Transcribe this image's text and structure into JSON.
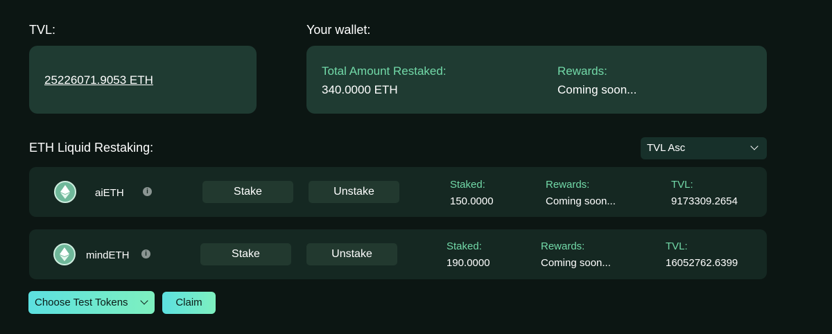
{
  "tvl": {
    "label": "TVL:",
    "value": "25226071.9053 ETH"
  },
  "wallet": {
    "label": "Your wallet:",
    "total_label": "Total Amount Restaked:",
    "total_value": "340.0000 ETH",
    "rewards_label": "Rewards:",
    "rewards_value": "Coming soon..."
  },
  "section": {
    "title": "ETH Liquid Restaking:",
    "sort_selected": "TVL Asc"
  },
  "rows": [
    {
      "name": "aiETH",
      "stake_label": "Stake",
      "unstake_label": "Unstake",
      "staked_label": "Staked:",
      "staked_value": "150.0000",
      "rewards_label": "Rewards:",
      "rewards_value": "Coming soon...",
      "tvl_label": "TVL:",
      "tvl_value": "9173309.2654"
    },
    {
      "name": "mindETH",
      "stake_label": "Stake",
      "unstake_label": "Unstake",
      "staked_label": "Staked:",
      "staked_value": "190.0000",
      "rewards_label": "Rewards:",
      "rewards_value": "Coming soon...",
      "tvl_label": "TVL:",
      "tvl_value": "16052762.6399"
    }
  ],
  "footer": {
    "choose_label": "Choose Test Tokens",
    "claim_label": "Claim"
  },
  "colors": {
    "background": "#0c1613",
    "card": "#1f3b32",
    "row": "#152822",
    "accent_text": "#72d9a8",
    "button_gradient_start": "#5ce0e0",
    "button_gradient_end": "#7ef0bf"
  },
  "icons": {
    "token": "ethereum-icon",
    "info": "info-icon",
    "dropdown": "chevron-down-icon"
  }
}
